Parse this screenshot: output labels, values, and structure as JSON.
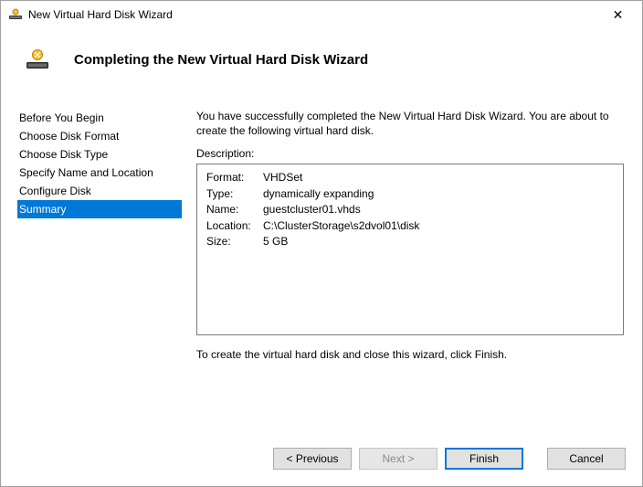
{
  "titlebar": {
    "title": "New Virtual Hard Disk Wizard"
  },
  "header": {
    "title": "Completing the New Virtual Hard Disk Wizard"
  },
  "sidebar": {
    "steps": [
      "Before You Begin",
      "Choose Disk Format",
      "Choose Disk Type",
      "Specify Name and Location",
      "Configure Disk",
      "Summary"
    ],
    "selected_index": 5
  },
  "main": {
    "intro": "You have successfully completed the New Virtual Hard Disk Wizard. You are about to create the following virtual hard disk.",
    "description_label": "Description:",
    "rows": [
      {
        "k": "Format:",
        "v": "VHDSet"
      },
      {
        "k": "Type:",
        "v": "dynamically expanding"
      },
      {
        "k": "Name:",
        "v": "guestcluster01.vhds"
      },
      {
        "k": "Location:",
        "v": "C:\\ClusterStorage\\s2dvol01\\disk"
      },
      {
        "k": "Size:",
        "v": "5 GB"
      }
    ],
    "hint": "To create the virtual hard disk and close this wizard, click Finish."
  },
  "footer": {
    "previous": "< Previous",
    "next": "Next >",
    "finish": "Finish",
    "cancel": "Cancel"
  }
}
